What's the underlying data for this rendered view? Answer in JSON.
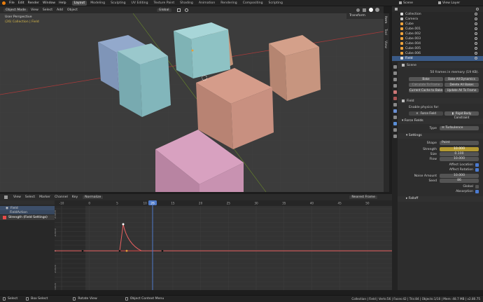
{
  "topbar": {
    "menus": [
      "File",
      "Edit",
      "Render",
      "Window",
      "Help"
    ],
    "workspaces": [
      "Layout",
      "Modeling",
      "Sculpting",
      "UV Editing",
      "Texture Paint",
      "Shading",
      "Animation",
      "Rendering",
      "Compositing",
      "Scripting"
    ],
    "active_workspace": "Layout",
    "scene": "Scene",
    "view_layer": "View Layer"
  },
  "viewport_header": {
    "mode": "Object Mode",
    "menus": [
      "View",
      "Select",
      "Add",
      "Object"
    ],
    "orientation": "Global"
  },
  "viewport": {
    "line1": "User Perspective",
    "line2": "(26) Collection | Field",
    "sidebar_tab": "Transform",
    "tabs": [
      "Item",
      "Tool",
      "View"
    ]
  },
  "outliner": {
    "items": [
      "Collection",
      "Camera",
      "Cube",
      "Cube.001",
      "Cube.002",
      "Cube.003",
      "Cube.004",
      "Cube.005",
      "Cube.006",
      "Field"
    ],
    "selected": "Field"
  },
  "scene_panel": {
    "title": "Scene",
    "frames_info": "50 frames in memory (19 KB).",
    "buttons": [
      "Bake",
      "Bake All Dynamics",
      "Calculate To Frame",
      "Delete All Bakes",
      "Current Cache to Bake",
      "Update All To Frame"
    ]
  },
  "physics": {
    "object": "Field",
    "enable_label": "Enable physics for:",
    "force_field": "Force Field",
    "rigid_body_constraint": "Rigid Body Constraint",
    "force_fields_header": "Force Fields",
    "type_label": "Type",
    "type_value": "Turbulence",
    "settings_header": "Settings",
    "shape_label": "Shape",
    "shape_value": "Point",
    "fields": [
      {
        "label": "Strength",
        "value": "10.000"
      },
      {
        "label": "Size",
        "value": "0.100"
      },
      {
        "label": "Flow",
        "value": "10.000"
      }
    ],
    "toggles": [
      "Affect Location",
      "Affect Rotation"
    ],
    "noise_label": "Noise Amount",
    "noise_value": "10.000",
    "seed_label": "Seed",
    "seed_value": "86",
    "global_label": "Global",
    "absorption_label": "Absorption",
    "falloff_header": "Falloff"
  },
  "timeline_header": {
    "menus": [
      "View",
      "Select",
      "Marker",
      "Channel",
      "Key"
    ],
    "editor": "Normalize",
    "interp": "Nearest Frame"
  },
  "channels": {
    "field": "Field",
    "action": "FieldAction",
    "fcurve": "Strength (Field Settings)"
  },
  "graph": {
    "current_frame": "26",
    "frame_ticks": [
      "-10",
      "0",
      "5",
      "10",
      "15",
      "20",
      "25",
      "30",
      "35",
      "40",
      "45",
      "50",
      "55",
      "60",
      "65",
      "70",
      "75",
      "80",
      "85",
      "90",
      "95",
      "100",
      "105",
      "110",
      "115"
    ],
    "y_ticks": [
      "20000",
      "10000",
      "0",
      "10000",
      "20000"
    ]
  },
  "statusbar": {
    "left": [
      "Select",
      "Box Select",
      "Rotate View",
      "Object Context Menu"
    ],
    "right": "Collection | Field | Verts:56 | Faces:42 | Tris:84 | Objects:1/10 | Mem: 48.7 MB | v2.80.75"
  }
}
